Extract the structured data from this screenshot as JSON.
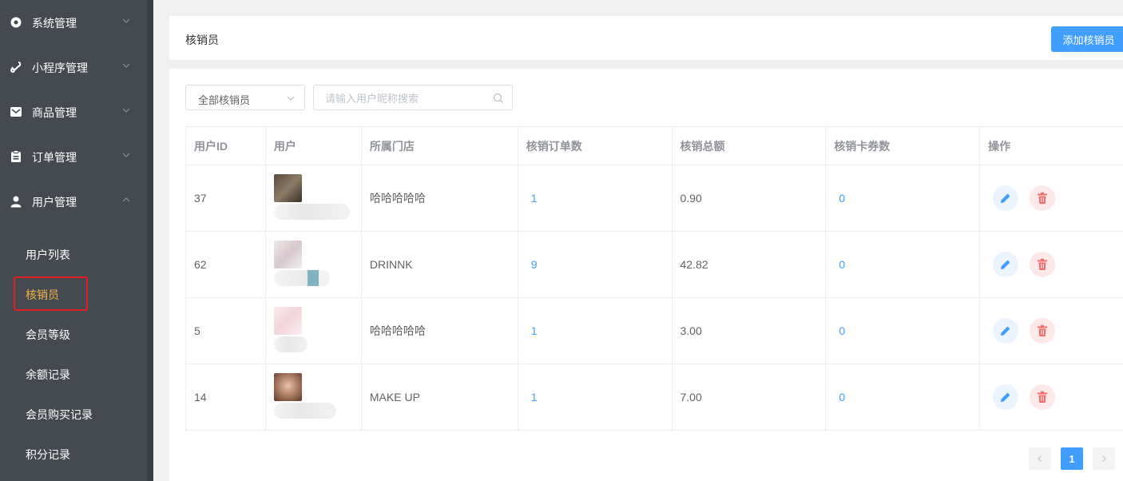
{
  "sidebar": {
    "menus": [
      {
        "label": "系统管理",
        "icon": "gear-icon"
      },
      {
        "label": "小程序管理",
        "icon": "link-icon"
      },
      {
        "label": "商品管理",
        "icon": "mail-icon"
      },
      {
        "label": "订单管理",
        "icon": "clipboard-icon"
      },
      {
        "label": "用户管理",
        "icon": "user-icon"
      }
    ],
    "sub_items": [
      {
        "label": "用户列表"
      },
      {
        "label": "核销员"
      },
      {
        "label": "会员等级"
      },
      {
        "label": "余额记录"
      },
      {
        "label": "会员购买记录"
      },
      {
        "label": "积分记录"
      }
    ]
  },
  "header": {
    "title": "核销员",
    "add_button": "添加核销员"
  },
  "filters": {
    "select_value": "全部核销员",
    "search_placeholder": "请输入用户昵称搜索"
  },
  "table": {
    "columns": [
      "用户ID",
      "用户",
      "所属门店",
      "核销订单数",
      "核销总额",
      "核销卡券数",
      "操作"
    ],
    "rows": [
      {
        "id": "37",
        "store": "哈哈哈哈哈",
        "orders": "1",
        "total": "0.90",
        "cards": "0"
      },
      {
        "id": "62",
        "store": "DRINNK",
        "orders": "9",
        "total": "42.82",
        "cards": "0"
      },
      {
        "id": "5",
        "store": "哈哈哈哈哈",
        "orders": "1",
        "total": "3.00",
        "cards": "0"
      },
      {
        "id": "14",
        "store": "MAKE UP",
        "orders": "1",
        "total": "7.00",
        "cards": "0"
      }
    ]
  },
  "pagination": {
    "current": "1"
  },
  "colors": {
    "primary": "#409eff",
    "danger": "#f56c6c",
    "sidebar_bg": "#444a50",
    "active_text": "#f5b342"
  }
}
